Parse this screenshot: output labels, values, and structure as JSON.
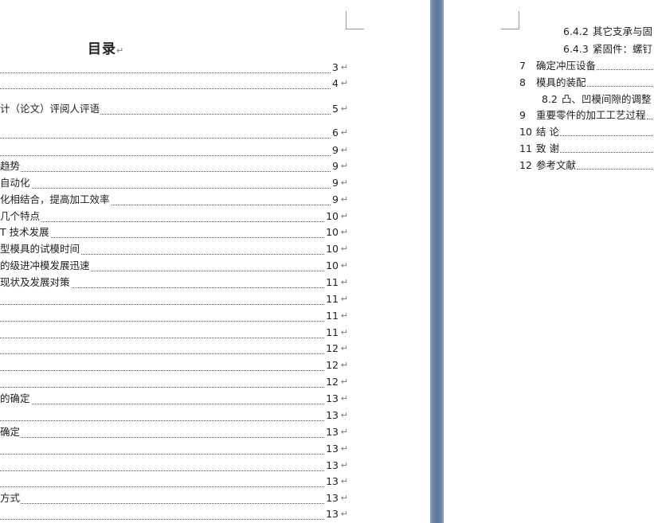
{
  "left_page": {
    "title": "目录",
    "para_mark": "↵",
    "entries": [
      {
        "label": "",
        "page": "3"
      },
      {
        "label": "",
        "page": "4"
      },
      {
        "label": "计（论文）评阅人评语",
        "page": "5"
      },
      {
        "label": "",
        "page": "6"
      },
      {
        "label": "",
        "page": "9"
      },
      {
        "label": "趋势",
        "page": "9"
      },
      {
        "label": "自动化",
        "page": "9"
      },
      {
        "label": "化相结合，提高加工效率",
        "page": "9"
      },
      {
        "label": "几个特点",
        "page": "10"
      },
      {
        "label": "T 技术发展",
        "page": "10"
      },
      {
        "label": "型模具的试模时间",
        "page": "10"
      },
      {
        "label": "的级进冲模发展迅速",
        "page": "10"
      },
      {
        "label": "现状及发展对策",
        "page": "11"
      },
      {
        "label": "",
        "page": "11"
      },
      {
        "label": "",
        "page": "11"
      },
      {
        "label": "",
        "page": "11"
      },
      {
        "label": "",
        "page": "12"
      },
      {
        "label": "",
        "page": "12"
      },
      {
        "label": "",
        "page": "12"
      },
      {
        "label": "的确定",
        "page": "13"
      },
      {
        "label": "",
        "page": "13"
      },
      {
        "label": "确定",
        "page": "13"
      },
      {
        "label": "",
        "page": "13"
      },
      {
        "label": "",
        "page": "13"
      },
      {
        "label": "",
        "page": "13"
      },
      {
        "label": "方式",
        "page": "13"
      },
      {
        "label": "",
        "page": "13"
      }
    ]
  },
  "right_page": {
    "entries": [
      {
        "num": "6.4.2",
        "text": "其它支承与固"
      },
      {
        "num": "6.4.3",
        "text": "紧固件：螺钉"
      },
      {
        "num": "7",
        "text": "确定冲压设备"
      },
      {
        "num": "8",
        "text": "模具的装配"
      },
      {
        "num": "8.2",
        "text": "凸、凹模间隙的调整"
      },
      {
        "num": "9",
        "text": "重要零件的加工工艺过程"
      },
      {
        "num": "10",
        "text": "结  论"
      },
      {
        "num": "11",
        "text": "致    谢"
      },
      {
        "num": "12",
        "text": "参考文献"
      }
    ]
  }
}
